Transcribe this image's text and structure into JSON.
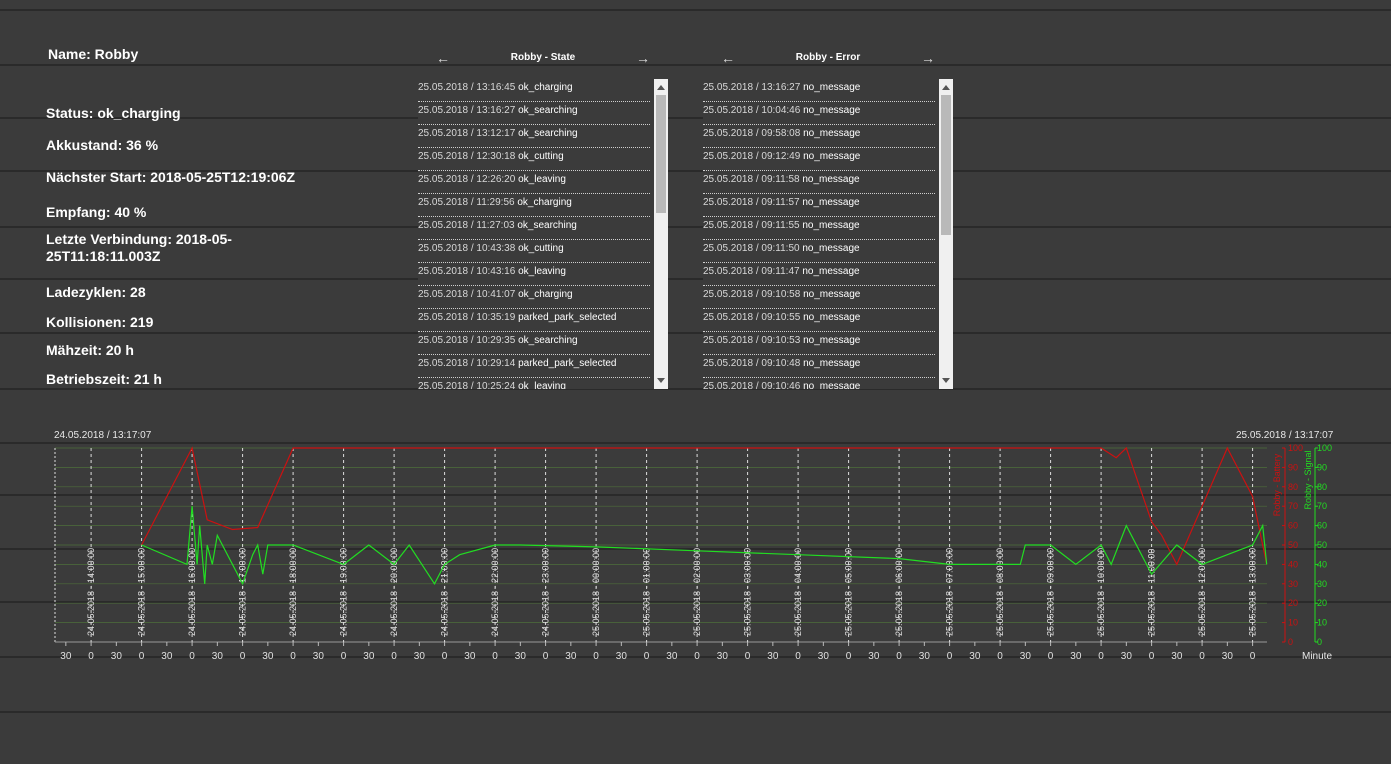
{
  "info": {
    "name": "Name: Robby",
    "status": "Status: ok_charging",
    "akku": "Akkustand: 36 %",
    "naechster_start": "Nächster Start: 2018-05-25T12:19:06Z",
    "empfang": "Empfang: 40 %",
    "letzte_verbindung": "Letzte Verbindung: 2018-05-25T11:18:11.003Z",
    "ladezyklen": "Ladezyklen: 28",
    "kollisionen": "Kollisionen: 219",
    "maehzeit": "Mähzeit: 20 h",
    "betriebszeit": "Betriebszeit: 21 h"
  },
  "state_log": {
    "title": "Robby - State",
    "prev_label": "←",
    "next_label": "→",
    "rows": [
      {
        "time": "25.05.2018 / 13:16:45",
        "msg": "ok_charging"
      },
      {
        "time": "25.05.2018 / 13:16:27",
        "msg": "ok_searching"
      },
      {
        "time": "25.05.2018 / 13:12:17",
        "msg": "ok_searching"
      },
      {
        "time": "25.05.2018 / 12:30:18",
        "msg": "ok_cutting"
      },
      {
        "time": "25.05.2018 / 12:26:20",
        "msg": "ok_leaving"
      },
      {
        "time": "25.05.2018 / 11:29:56",
        "msg": "ok_charging"
      },
      {
        "time": "25.05.2018 / 11:27:03",
        "msg": "ok_searching"
      },
      {
        "time": "25.05.2018 / 10:43:38",
        "msg": "ok_cutting"
      },
      {
        "time": "25.05.2018 / 10:43:16",
        "msg": "ok_leaving"
      },
      {
        "time": "25.05.2018 / 10:41:07",
        "msg": "ok_charging"
      },
      {
        "time": "25.05.2018 / 10:35:19",
        "msg": "parked_park_selected"
      },
      {
        "time": "25.05.2018 / 10:29:35",
        "msg": "ok_searching"
      },
      {
        "time": "25.05.2018 / 10:29:14",
        "msg": "parked_park_selected"
      },
      {
        "time": "25.05.2018 / 10:25:24",
        "msg": "ok_leaving"
      }
    ]
  },
  "error_log": {
    "title": "Robby - Error",
    "prev_label": "←",
    "next_label": "→",
    "rows": [
      {
        "time": "25.05.2018 / 13:16:27",
        "msg": "no_message"
      },
      {
        "time": "25.05.2018 / 10:04:46",
        "msg": "no_message"
      },
      {
        "time": "25.05.2018 / 09:58:08",
        "msg": "no_message"
      },
      {
        "time": "25.05.2018 / 09:12:49",
        "msg": "no_message"
      },
      {
        "time": "25.05.2018 / 09:11:58",
        "msg": "no_message"
      },
      {
        "time": "25.05.2018 / 09:11:57",
        "msg": "no_message"
      },
      {
        "time": "25.05.2018 / 09:11:55",
        "msg": "no_message"
      },
      {
        "time": "25.05.2018 / 09:11:50",
        "msg": "no_message"
      },
      {
        "time": "25.05.2018 / 09:11:47",
        "msg": "no_message"
      },
      {
        "time": "25.05.2018 / 09:10:58",
        "msg": "no_message"
      },
      {
        "time": "25.05.2018 / 09:10:55",
        "msg": "no_message"
      },
      {
        "time": "25.05.2018 / 09:10:53",
        "msg": "no_message"
      },
      {
        "time": "25.05.2018 / 09:10:48",
        "msg": "no_message"
      },
      {
        "time": "25.05.2018 / 09:10:46",
        "msg": "no_message"
      }
    ]
  },
  "chart_data": {
    "type": "line",
    "range_start_label": "24.05.2018 / 13:17:07",
    "range_end_label": "25.05.2018 / 13:17:07",
    "xlabel": "Minute",
    "x_domain_hours": [
      13.2853,
      37.2853
    ],
    "x_ticks_hours": [
      14,
      15,
      16,
      17,
      18,
      19,
      20,
      21,
      22,
      23,
      24,
      25,
      26,
      27,
      28,
      29,
      30,
      31,
      32,
      33,
      34,
      35,
      36,
      37
    ],
    "x_tick_labels": [
      "24.05.2018 - 14:00:00",
      "24.05.2018 - 15:00:00",
      "24.05.2018 - 16:00:00",
      "24.05.2018 - 17:00:00",
      "24.05.2018 - 18:00:00",
      "24.05.2018 - 19:00:00",
      "24.05.2018 - 20:00:00",
      "24.05.2018 - 21:00:00",
      "24.05.2018 - 22:00:00",
      "24.05.2018 - 23:00:00",
      "25.05.2018 - 00:00:00",
      "25.05.2018 - 01:00:00",
      "25.05.2018 - 02:00:00",
      "25.05.2018 - 03:00:00",
      "25.05.2018 - 04:00:00",
      "25.05.2018 - 05:00:00",
      "25.05.2018 - 06:00:00",
      "25.05.2018 - 07:00:00",
      "25.05.2018 - 08:00:00",
      "25.05.2018 - 09:00:00",
      "25.05.2018 - 10:00:00",
      "25.05.2018 - 11:00:00",
      "25.05.2018 - 12:00:00",
      "25.05.2018 - 13:00:00"
    ],
    "minute_ticks_hours": [
      13.5,
      14,
      14.5,
      15,
      15.5,
      16,
      16.5,
      17,
      17.5,
      18,
      18.5,
      19,
      19.5,
      20,
      20.5,
      21,
      21.5,
      22,
      22.5,
      23,
      23.5,
      24,
      24.5,
      25,
      25.5,
      26,
      26.5,
      27,
      27.5,
      28,
      28.5,
      29,
      29.5,
      30,
      30.5,
      31,
      31.5,
      32,
      32.5,
      33,
      33.5,
      34,
      34.5,
      35,
      35.5,
      36,
      36.5,
      37
    ],
    "minute_tick_labels": [
      "30",
      "0",
      "30",
      "0",
      "30",
      "0",
      "30",
      "0",
      "30",
      "0",
      "30",
      "0",
      "30",
      "0",
      "30",
      "0",
      "30",
      "0",
      "30",
      "0",
      "30",
      "0",
      "30",
      "0",
      "30",
      "0",
      "30",
      "0",
      "30",
      "0",
      "30",
      "0",
      "30",
      "0",
      "30",
      "0",
      "30",
      "0",
      "30",
      "0",
      "30",
      "0",
      "30",
      "0",
      "30",
      "0",
      "30",
      "0"
    ],
    "ylim": [
      0,
      100
    ],
    "y_ticks": [
      0,
      10,
      20,
      30,
      40,
      50,
      60,
      70,
      80,
      90,
      100
    ],
    "y_tick_labels": [
      "0",
      "10",
      "20",
      "30",
      "40",
      "50",
      "60",
      "70",
      "80",
      "90",
      "100"
    ],
    "series": [
      {
        "name": "Robby - Battery",
        "color": "#cc1111",
        "x": [
          15.0,
          16.0,
          16.3,
          16.8,
          17.3,
          18.0,
          34.0,
          34.3,
          34.5,
          35.0,
          35.2,
          35.5,
          36.0,
          36.5,
          37.0,
          37.28
        ],
        "y": [
          50,
          100,
          63,
          58,
          59,
          100,
          100,
          95,
          100,
          62,
          55,
          40,
          70,
          100,
          75,
          40
        ]
      },
      {
        "name": "Robby - Signal",
        "color": "#22dd22",
        "x": [
          15.0,
          15.9,
          16.0,
          16.1,
          16.15,
          16.25,
          16.3,
          16.4,
          16.5,
          17.0,
          17.2,
          17.3,
          17.4,
          17.5,
          18.0,
          19.0,
          19.5,
          20.0,
          20.3,
          20.8,
          21.0,
          21.3,
          22.0,
          22.5,
          24.0,
          26.0,
          28.0,
          30.0,
          31.0,
          32.4,
          32.5,
          33.0,
          33.5,
          34.0,
          34.2,
          34.5,
          35.0,
          35.5,
          36.0,
          36.5,
          37.0,
          37.2,
          37.28
        ],
        "y": [
          50,
          40,
          70,
          40,
          60,
          30,
          50,
          40,
          55,
          30,
          45,
          50,
          35,
          50,
          50,
          40,
          50,
          40,
          50,
          30,
          40,
          45,
          50,
          50,
          49,
          47,
          45,
          43,
          40,
          40,
          50,
          50,
          40,
          50,
          40,
          60,
          35,
          50,
          40,
          45,
          50,
          60,
          40
        ]
      }
    ],
    "y_axis_titles": [
      "Robby - Battery",
      "Robby - Signal"
    ]
  }
}
